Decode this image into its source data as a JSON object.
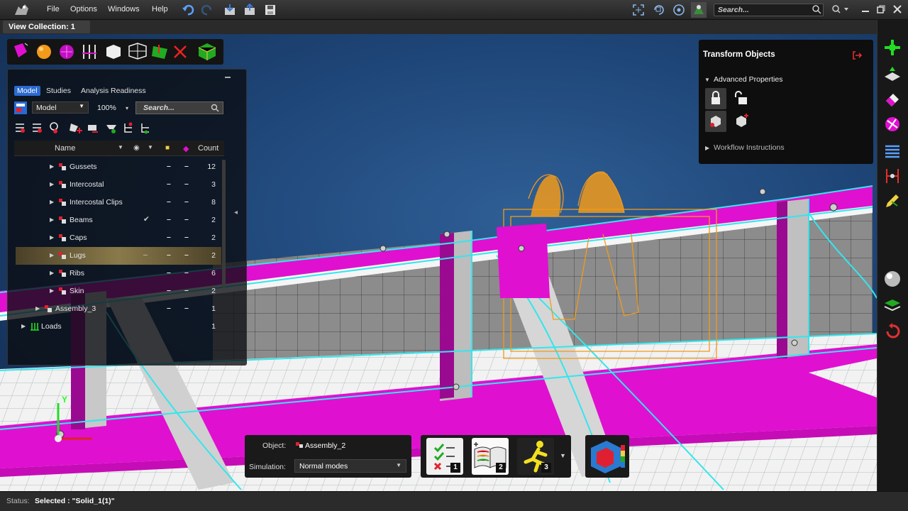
{
  "menubar": {
    "items": [
      "File",
      "Options",
      "Windows",
      "Help"
    ],
    "search_placeholder": "Search..."
  },
  "collection_tab": "View Collection: 1",
  "model_panel": {
    "tabs": [
      "Model",
      "Studies",
      "Analysis Readiness"
    ],
    "model_select": "Model",
    "zoom": "100%",
    "search_placeholder": "Search...",
    "columns": {
      "name": "Name",
      "count": "Count"
    },
    "rows": [
      {
        "label": "Gussets",
        "count": "12",
        "d1": "–",
        "d2": "–",
        "check": ""
      },
      {
        "label": "Intercostal",
        "count": "3",
        "d1": "–",
        "d2": "–",
        "check": ""
      },
      {
        "label": "Intercostal Clips",
        "count": "8",
        "d1": "–",
        "d2": "–",
        "check": ""
      },
      {
        "label": "Beams",
        "count": "2",
        "d1": "–",
        "d2": "–",
        "check": "✔"
      },
      {
        "label": "Caps",
        "count": "2",
        "d1": "–",
        "d2": "–",
        "check": ""
      },
      {
        "label": "Lugs",
        "count": "2",
        "d1": "–",
        "d2": "–",
        "check": "–"
      },
      {
        "label": "Ribs",
        "count": "6",
        "d1": "–",
        "d2": "–",
        "check": ""
      },
      {
        "label": "Skin",
        "count": "2",
        "d1": "–",
        "d2": "–",
        "check": ""
      },
      {
        "label": "Assembly_3",
        "count": "1",
        "d1": "–",
        "d2": "–",
        "check": ""
      },
      {
        "label": "Loads",
        "count": "1",
        "d1": "",
        "d2": "",
        "check": ""
      }
    ]
  },
  "transform_panel": {
    "title": "Transform Objects",
    "advanced": "Advanced Properties",
    "workflow": "Workflow Instructions"
  },
  "object_panel": {
    "object_label": "Object:",
    "object_value": "Assembly_2",
    "simulation_label": "Simulation:",
    "simulation_value": "Normal modes"
  },
  "sim_buttons": [
    "1",
    "2",
    "3"
  ],
  "axes": {
    "y": "Y"
  },
  "status": {
    "label": "Status:",
    "value": "Selected : \"Solid_1(1)\""
  },
  "colors": {
    "magenta": "#e010d0",
    "cyan": "#33e6ee",
    "orange": "#f29a1a",
    "grey": "#8a8a8a"
  }
}
